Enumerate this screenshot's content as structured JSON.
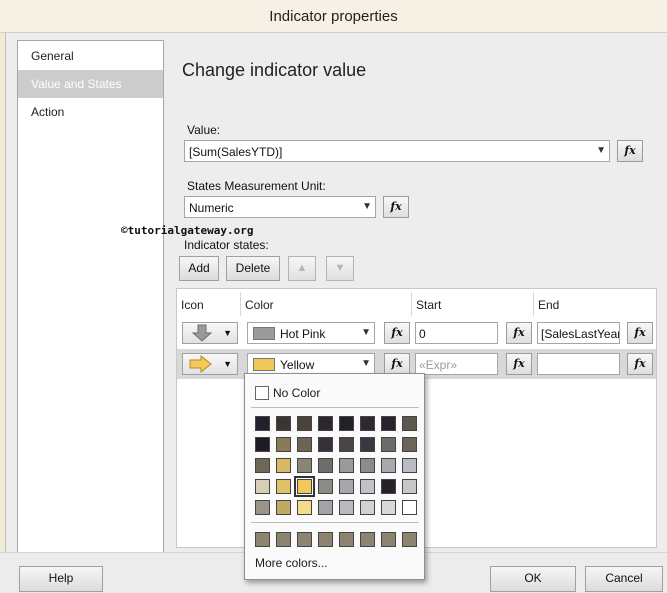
{
  "window": {
    "title": "Indicator properties"
  },
  "nav": {
    "items": [
      {
        "label": "General",
        "active": false
      },
      {
        "label": "Value and States",
        "active": true
      },
      {
        "label": "Action",
        "active": false
      }
    ]
  },
  "page": {
    "heading": "Change indicator value",
    "value_label": "Value:",
    "value": "[Sum(SalesYTD)]",
    "unit_label": "States Measurement Unit:",
    "unit_value": "Numeric",
    "watermark": "©tutorialgateway.org",
    "states_label": "Indicator states:",
    "fx_label": "fx"
  },
  "toolbar": {
    "add": "Add",
    "delete": "Delete",
    "up_icon": "move-up-icon",
    "down_icon": "move-down-icon"
  },
  "grid": {
    "columns": [
      "Icon",
      "Color",
      "Start",
      "End"
    ],
    "rows": [
      {
        "icon": "down-arrow-gray-icon",
        "color": "Hot Pink",
        "start": "0",
        "end": "[SalesLastYear]"
      },
      {
        "icon": "right-arrow-yellow-icon",
        "color": "Yellow",
        "start": "",
        "start_placeholder": "«Expr»",
        "end": ""
      }
    ]
  },
  "color_picker": {
    "no_color": "No Color",
    "more_colors": "More colors...",
    "palette": [
      "#241f2c",
      "#3b3531",
      "#4a4338",
      "#2d2630",
      "#24202a",
      "#2f2831",
      "#29222c",
      "#5e574c",
      "#1f1b25",
      "#8b7a57",
      "#6d6553",
      "#38313a",
      "#4a4447",
      "#3c3640",
      "#6d6b6a",
      "#6b6457",
      "#6d6856",
      "#d6b961",
      "#8b8576",
      "#6f6d6a",
      "#9b9a99",
      "#8b8c8f",
      "#a8aab0",
      "#b9bcc1",
      "#d7cfb4",
      "#e0c16a",
      "#f0c95a",
      "#8d8b85",
      "#a5a7ab",
      "#bfc2c7",
      "#262126",
      "#c6c7c9",
      "#9a9488",
      "#c2a862",
      "#f2dc8a",
      "#a1a3a7",
      "#b8babf",
      "#cfd1d6",
      "#d7d9dd",
      "#ffffff"
    ],
    "selected_index": 26
  },
  "footer": {
    "help": "Help",
    "ok": "OK",
    "cancel": "Cancel"
  }
}
